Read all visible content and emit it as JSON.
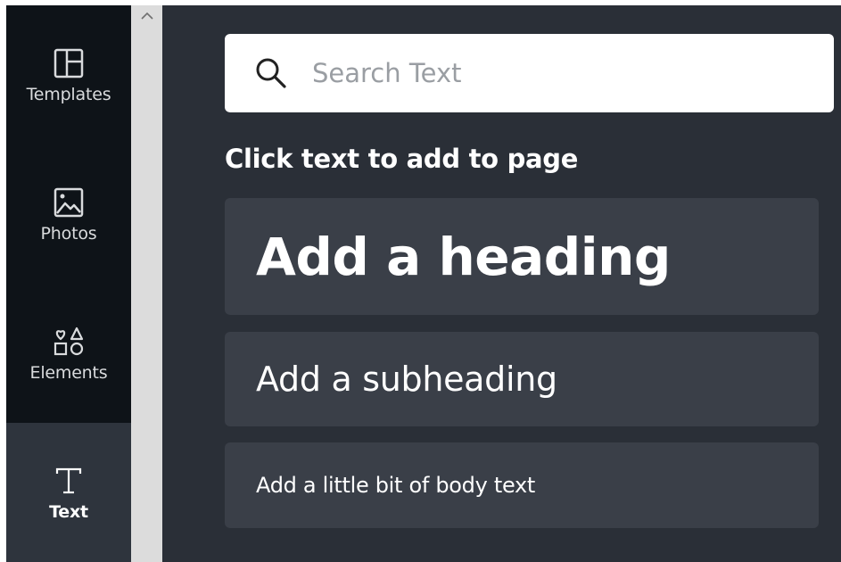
{
  "sidebar": {
    "items": [
      {
        "label": "Templates",
        "icon": "templates-icon"
      },
      {
        "label": "Photos",
        "icon": "photos-icon"
      },
      {
        "label": "Elements",
        "icon": "elements-icon"
      },
      {
        "label": "Text",
        "icon": "text-icon",
        "active": true
      }
    ]
  },
  "search": {
    "placeholder": "Search Text",
    "value": ""
  },
  "main": {
    "hint": "Click text to add to page",
    "cards": {
      "heading": "Add a heading",
      "subheading": "Add a subheading",
      "body": "Add a little bit of body text"
    }
  },
  "colors": {
    "rail_bg": "#0e1318",
    "active_bg": "#2e343d",
    "panel_bg": "#2a2f37",
    "card_bg": "#3a3f48",
    "text": "#ffffff"
  }
}
